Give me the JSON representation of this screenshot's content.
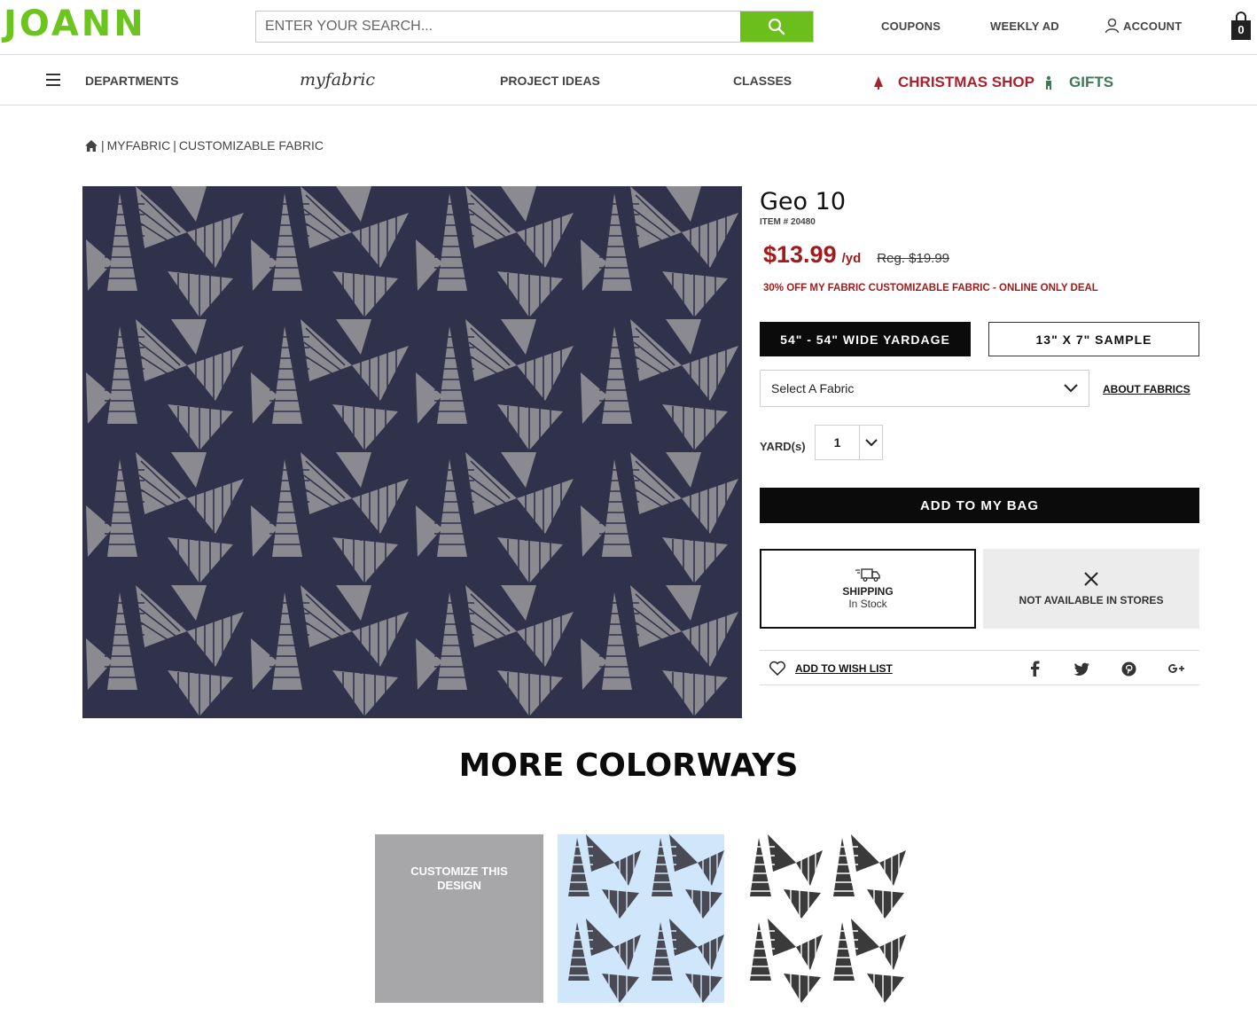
{
  "header": {
    "logo": "JOANN",
    "search": {
      "placeholder": "ENTER YOUR SEARCH..."
    },
    "links": {
      "coupons": "COUPONS",
      "weekly_ad": "WEEKLY AD",
      "account": "ACCOUNT"
    },
    "bag_count": "0"
  },
  "nav": {
    "departments": "DEPARTMENTS",
    "myfabric": "myfabric",
    "project_ideas": "PROJECT IDEAS",
    "classes": "CLASSES",
    "christmas_shop": "CHRISTMAS SHOP",
    "gifts": "GIFTS",
    "colors": {
      "christmas": "#a8212e",
      "gifts": "#3c7a57"
    }
  },
  "breadcrumb": [
    "MYFABRIC",
    "CUSTOMIZABLE FABRIC"
  ],
  "product": {
    "title": "Geo 10",
    "item_number": "ITEM # 20480",
    "price": "$13.99",
    "unit": "/yd",
    "regular_price": "Reg. $19.99",
    "promo": "30% OFF MY FABRIC CUSTOMIZABLE FABRIC - ONLINE ONLY DEAL",
    "options": [
      "54\" - 54\" WIDE YARDAGE",
      "13\" X 7\" SAMPLE"
    ],
    "fabric_select": "Select A Fabric",
    "about_fabrics": "ABOUT FABRICS",
    "yard_label": "YARD(s)",
    "quantity": "1",
    "add_to_bag": "ADD TO MY BAG",
    "shipping_title": "SHIPPING",
    "shipping_status": "In Stock",
    "store_status": "NOT AVAILABLE IN STORES",
    "wish_list": "ADD TO WISH LIST",
    "social_icons": [
      "facebook-icon",
      "twitter-icon",
      "pinterest-icon",
      "google-plus-icon"
    ],
    "colors": {
      "price": "#a01c1c",
      "accent": "#6cbf1a",
      "fabric_bg": "#30314b",
      "fabric_motif": "#8b8a90"
    }
  },
  "colorways": {
    "title": "MORE COLORWAYS",
    "customize_label": "CUSTOMIZE THIS DESIGN",
    "swatches": [
      {
        "name": "light-blue-colorway",
        "background": "#cfe6fb",
        "motif": "#4a4a55"
      },
      {
        "name": "white-colorway",
        "background": "#ffffff",
        "motif": "#3a3a3a"
      }
    ]
  }
}
